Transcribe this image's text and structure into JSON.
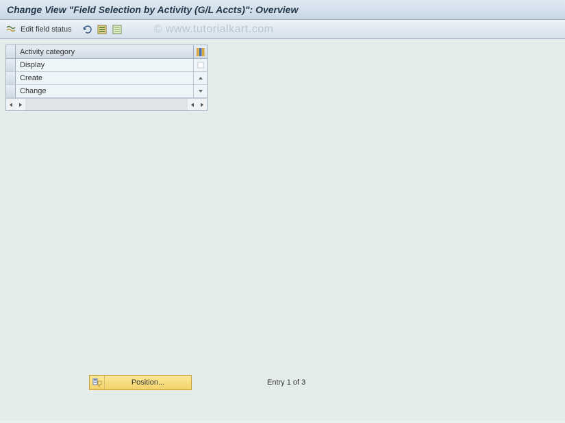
{
  "title": "Change View \"Field Selection by Activity (G/L Accts)\": Overview",
  "toolbar": {
    "edit_field_status": "Edit field status"
  },
  "watermark": "© www.tutorialkart.com",
  "table": {
    "header": "Activity category",
    "rows": [
      "Display",
      "Create",
      "Change"
    ]
  },
  "footer": {
    "position_label": "Position...",
    "entry_text": "Entry 1 of 3"
  }
}
